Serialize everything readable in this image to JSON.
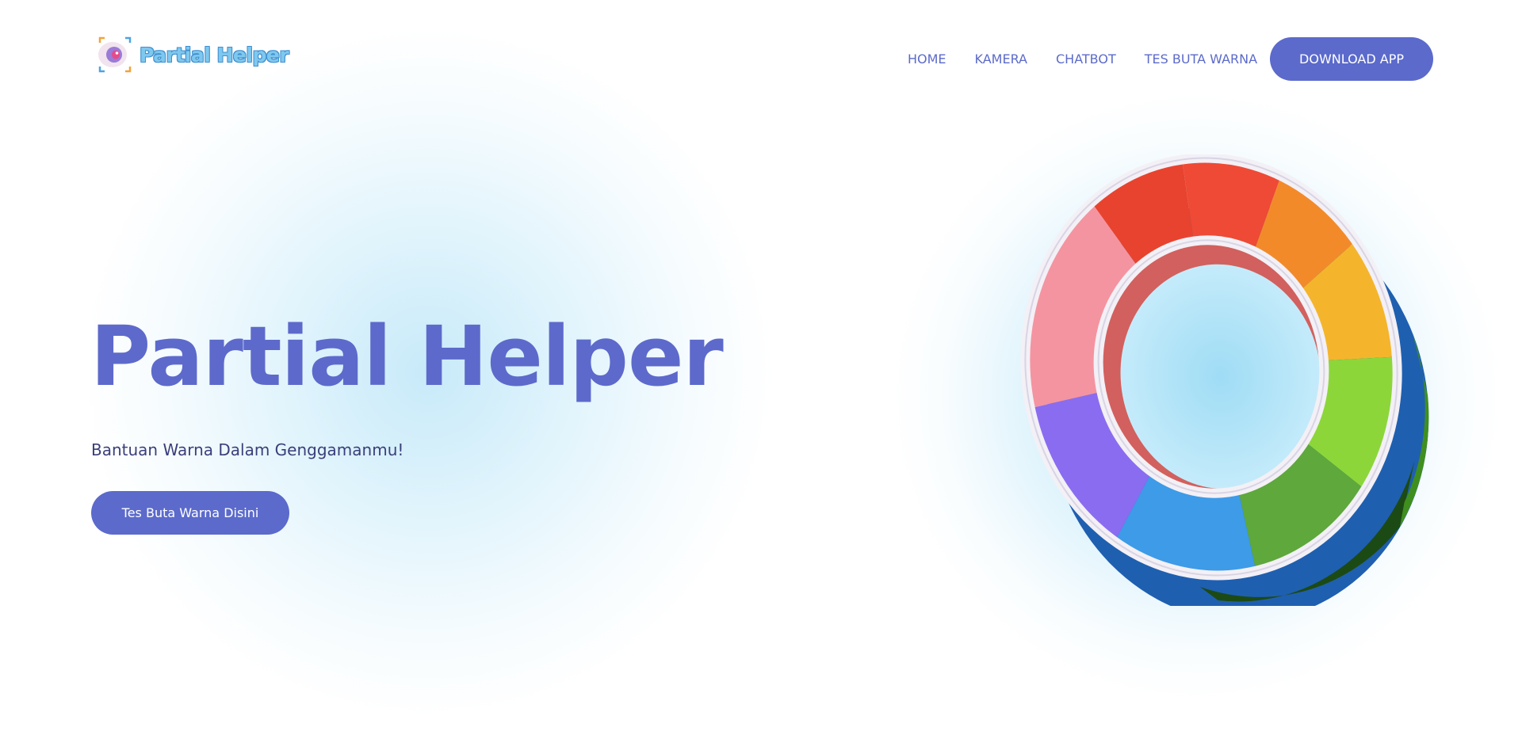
{
  "header": {
    "logo_text": "Partial Helper",
    "logo_icon": "eye-logo-icon",
    "nav": [
      {
        "label": "HOME"
      },
      {
        "label": "KAMERA"
      },
      {
        "label": "CHATBOT"
      },
      {
        "label": "TES BUTA WARNA"
      }
    ],
    "download_label": "DOWNLOAD APP"
  },
  "hero": {
    "title": "Partial Helper",
    "subtitle": "Bantuan Warna Dalam Genggamanmu!",
    "cta_label": "Tes Buta Warna Disini",
    "illustration": "color-wheel-ring-illustration"
  },
  "colors": {
    "primary": "#5b6acb",
    "subtitle_text": "#3a3f7a",
    "glow": "#bfe6f8",
    "wheel_segments": [
      "#ee4a36",
      "#f28a2a",
      "#f4b52c",
      "#8cd63a",
      "#5ea83c",
      "#3d9be8",
      "#8a6cf0",
      "#f494a0"
    ]
  }
}
